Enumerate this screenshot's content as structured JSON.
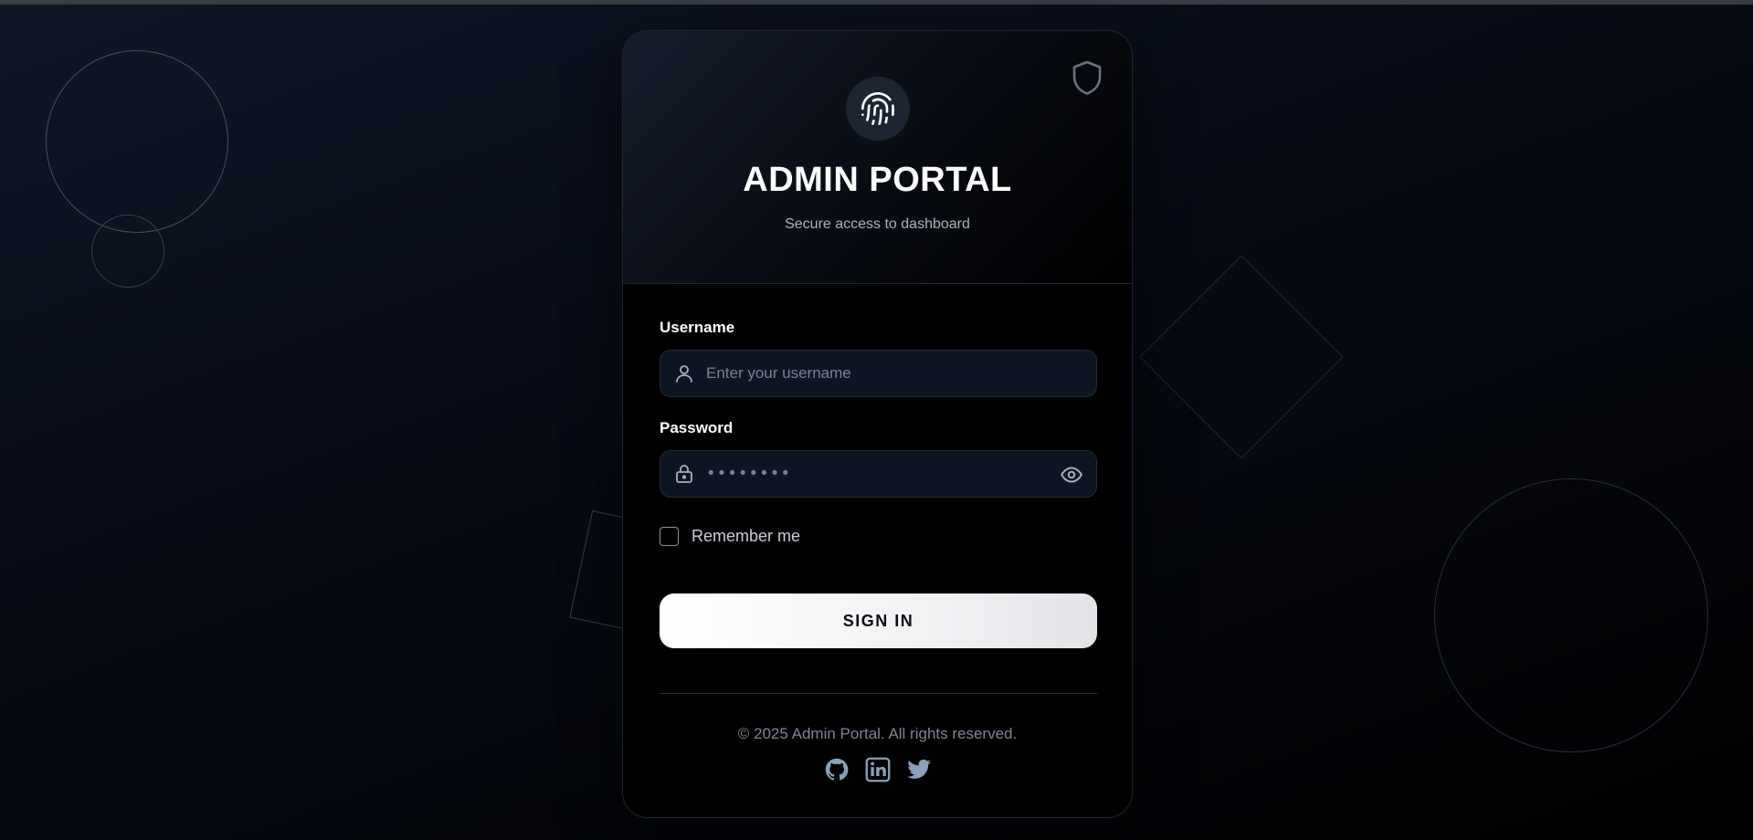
{
  "header": {
    "title": "ADMIN PORTAL",
    "subtitle": "Secure access to dashboard",
    "icon": "fingerprint-icon",
    "corner_icon": "shield-icon"
  },
  "form": {
    "username_label": "Username",
    "username_placeholder": "Enter your username",
    "username_value": "",
    "password_label": "Password",
    "password_value": "••••••••",
    "remember_label": "Remember me",
    "remember_checked": false,
    "submit_label": "SIGN IN"
  },
  "footer": {
    "copyright": "© 2025 Admin Portal. All rights reserved.",
    "social": [
      "github-icon",
      "linkedin-icon",
      "twitter-icon"
    ]
  },
  "colors": {
    "background": "#070b14",
    "card": "#000000",
    "input_bg": "#0e1522",
    "accent": "#ffffff",
    "muted_text": "#7d8595"
  }
}
